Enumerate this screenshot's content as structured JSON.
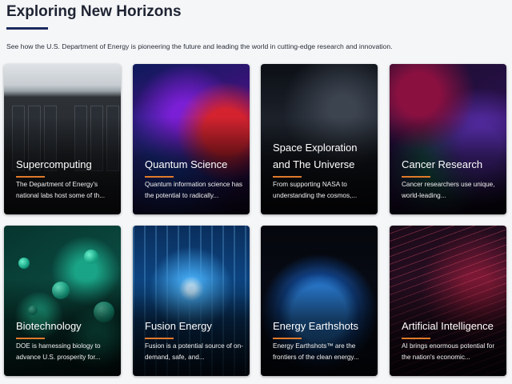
{
  "header": {
    "title": "Exploring New Horizons",
    "subtitle": "See how the U.S. Department of Energy is pioneering the future and leading the world in cutting-edge research and innovation."
  },
  "cards": [
    {
      "title": "Supercomputing",
      "description": "The Department of Energy's national labs host some of th..."
    },
    {
      "title": "Quantum Science",
      "description": "Quantum information science has the potential to radically..."
    },
    {
      "title": "Space Exploration and The Universe",
      "description": "From supporting NASA to understanding the cosmos,..."
    },
    {
      "title": "Cancer Research",
      "description": "Cancer researchers use unique, world-leading..."
    },
    {
      "title": "Biotechnology",
      "description": "DOE is harnessing biology to advance U.S. prosperity for..."
    },
    {
      "title": "Fusion Energy",
      "description": "Fusion is a potential source of on-demand, safe, and..."
    },
    {
      "title": "Energy Earthshots",
      "description": "Energy Earthshots™ are the frontiers of the clean energy..."
    },
    {
      "title": "Artificial Intelligence",
      "description": "AI brings enormous potential for the nation's economic..."
    }
  ],
  "colors": {
    "title_rule": "#1b2a5e",
    "card_accent": "#e07a2a",
    "page_bg": "#f5f6f8"
  }
}
